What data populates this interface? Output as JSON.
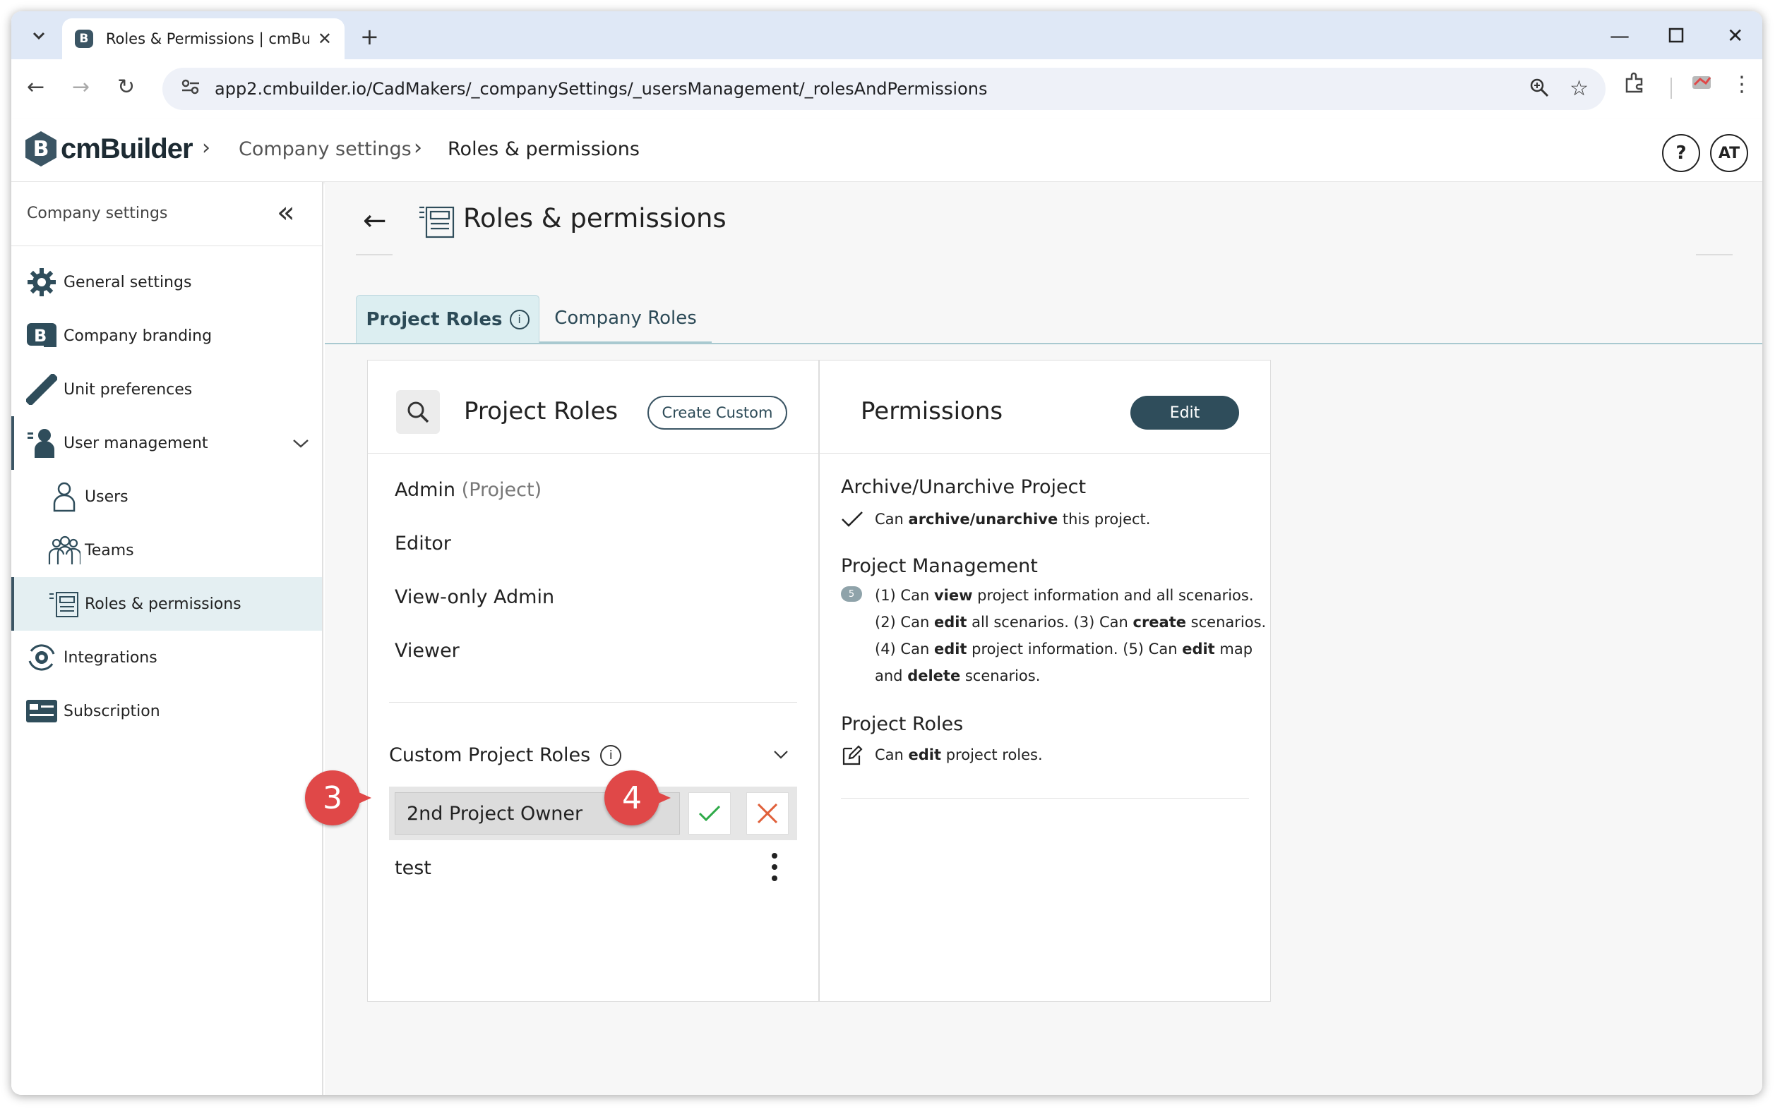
{
  "browser": {
    "tab_title": "Roles & Permissions | cmBuilder",
    "url": "app2.cmbuilder.io/CadMakers/_companySettings/_usersManagement/_rolesAndPermissions"
  },
  "header": {
    "logo_text": "cmBuilder",
    "breadcrumbs": [
      "Company settings",
      "Roles & permissions"
    ],
    "help_label": "?",
    "avatar_initials": "AT"
  },
  "sidebar": {
    "title": "Company settings",
    "items": [
      {
        "label": "General settings",
        "icon": "gear-icon"
      },
      {
        "label": "Company branding",
        "icon": "branding-icon"
      },
      {
        "label": "Unit preferences",
        "icon": "ruler-icon"
      },
      {
        "label": "User management",
        "icon": "user-management-icon"
      },
      {
        "label": "Users",
        "icon": "user-icon"
      },
      {
        "label": "Teams",
        "icon": "team-icon"
      },
      {
        "label": "Roles & permissions",
        "icon": "roles-icon"
      },
      {
        "label": "Integrations",
        "icon": "integrations-icon"
      },
      {
        "label": "Subscription",
        "icon": "subscription-icon"
      }
    ]
  },
  "main": {
    "page_title": "Roles & permissions",
    "tabs": [
      {
        "label": "Project Roles",
        "active": true
      },
      {
        "label": "Company Roles",
        "active": false
      }
    ],
    "roles_panel": {
      "title": "Project Roles",
      "create_label": "Create Custom",
      "roles": [
        {
          "name": "Admin",
          "suffix": "(Project)"
        },
        {
          "name": "Editor",
          "suffix": ""
        },
        {
          "name": "View-only Admin",
          "suffix": ""
        },
        {
          "name": "Viewer",
          "suffix": ""
        }
      ],
      "custom_header": "Custom Project Roles",
      "edit_value": "2nd Project Owner",
      "custom_roles": [
        "test"
      ]
    },
    "permissions_panel": {
      "title": "Permissions",
      "edit_label": "Edit",
      "archive_heading": "Archive/Unarchive Project",
      "archive_text": [
        "Can ",
        "archive/unarchive",
        " this project."
      ],
      "pm_heading": "Project Management",
      "pm_badge": "5",
      "pm_lines": [
        [
          "(1) Can ",
          "view",
          " project information and all scenarios."
        ],
        [
          "(2) Can ",
          "edit",
          " all scenarios. (3) Can ",
          "create",
          " scenarios."
        ],
        [
          "(4) Can ",
          "edit",
          " project information. (5) Can ",
          "edit",
          " map"
        ],
        [
          "and ",
          "delete",
          " scenarios."
        ]
      ],
      "roles_heading": "Project Roles",
      "roles_text": [
        "Can ",
        "edit",
        " project roles."
      ]
    },
    "callouts": [
      "3",
      "4"
    ]
  },
  "colors": {
    "accent": "#2f4d5b",
    "tab_active_bg": "#dceef1",
    "callout": "#e04848",
    "confirm": "#2eaa48",
    "cancel": "#e0603a"
  }
}
